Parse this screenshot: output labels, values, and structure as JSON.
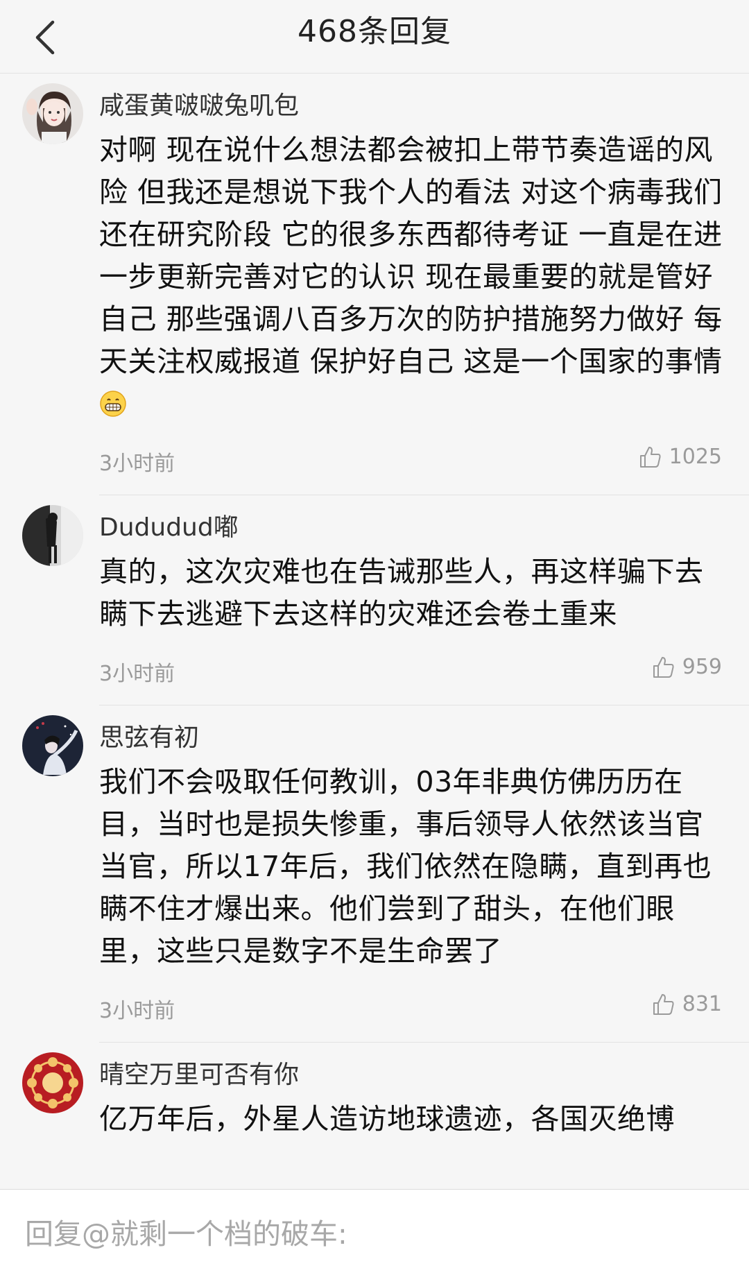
{
  "header": {
    "title": "468条回复",
    "back_icon": "chevron-left-icon"
  },
  "comments": [
    {
      "username": "咸蛋黄啵啵兔叽包",
      "text": "对啊 现在说什么想法都会被扣上带节奏造谣的风险 但我还是想说下我个人的看法 对这个病毒我们还在研究阶段 它的很多东西都待考证 一直是在进一步更新完善对它的认识 现在最重要的就是管好自己 那些强调八百多万次的防护措施努力做好 每天关注权威报道 保护好自己 这是一个国家的事情",
      "emoji": "grinning-face-emoji",
      "time": "3小时前",
      "likes": "1025"
    },
    {
      "username": "Dududud嘟",
      "text": "真的，这次灾难也在告诫那些人，再这样骗下去瞒下去逃避下去这样的灾难还会卷土重来",
      "time": "3小时前",
      "likes": "959"
    },
    {
      "username": "思弦有初",
      "text": "我们不会吸取任何教训，03年非典仿佛历历在目，当时也是损失惨重，事后领导人依然该当官当官，所以17年后，我们依然在隐瞒，直到再也瞒不住才爆出来。他们尝到了甜头，在他们眼里，这些只是数字不是生命罢了",
      "time": "3小时前",
      "likes": "831"
    },
    {
      "username": "晴空万里可否有你",
      "text": "亿万年后，外星人造访地球遗迹，各国灭绝博"
    }
  ],
  "reply": {
    "placeholder": "回复@就剩一个档的破车:"
  },
  "colors": {
    "background": "#f6f6f6",
    "text_primary": "#111111",
    "text_secondary": "#9a9a9a",
    "divider": "#e2e2e2"
  }
}
